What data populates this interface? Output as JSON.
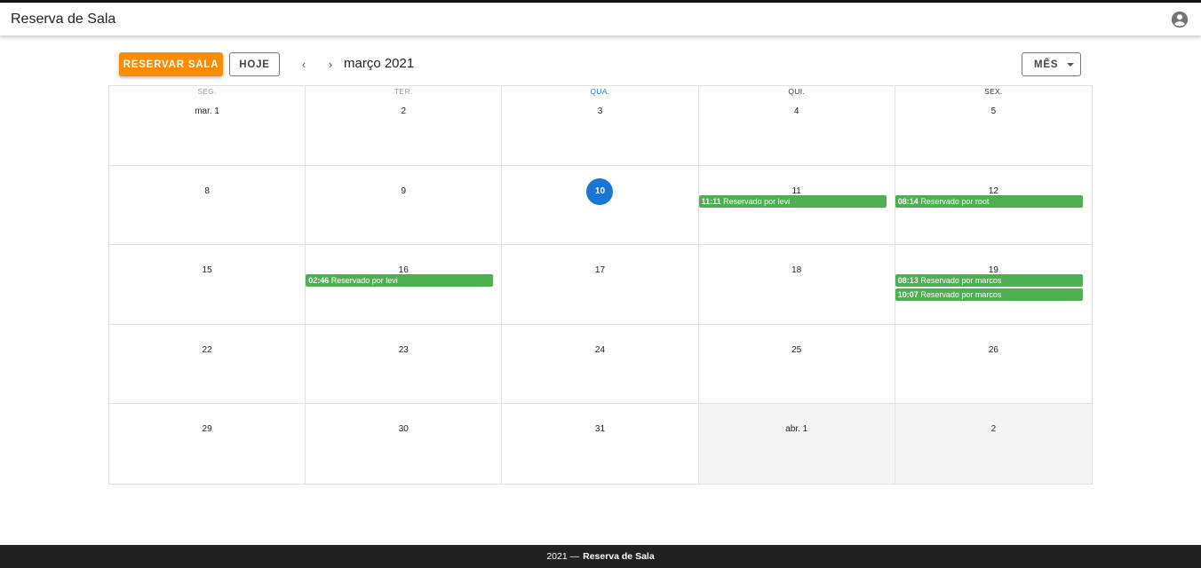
{
  "app": {
    "title": "Reserva de Sala",
    "account_icon": "account-circle-icon"
  },
  "toolbar": {
    "reserve_label": "RESERVAR SALA",
    "today_label": "HOJE",
    "prev_icon": "chevron-left-icon",
    "next_icon": "chevron-right-icon",
    "month_label": "março 2021",
    "view_label": "MÊS",
    "view_caret_icon": "caret-down-icon"
  },
  "weekdays": [
    "SEG.",
    "TER.",
    "QUA.",
    "QUI.",
    "SEX."
  ],
  "weeks": [
    [
      {
        "label": "mar. 1",
        "events": []
      },
      {
        "label": "2",
        "events": []
      },
      {
        "label": "3",
        "events": []
      },
      {
        "label": "4",
        "events": []
      },
      {
        "label": "5",
        "events": []
      }
    ],
    [
      {
        "label": "8",
        "events": []
      },
      {
        "label": "9",
        "events": []
      },
      {
        "label": "10",
        "today": true,
        "events": []
      },
      {
        "label": "11",
        "events": [
          {
            "time": "11:11",
            "text": "Reservado por levi"
          }
        ]
      },
      {
        "label": "12",
        "events": [
          {
            "time": "08:14",
            "text": "Reservado por root"
          }
        ]
      }
    ],
    [
      {
        "label": "15",
        "events": []
      },
      {
        "label": "16",
        "events": [
          {
            "time": "02:46",
            "text": "Reservado por levi"
          }
        ]
      },
      {
        "label": "17",
        "events": []
      },
      {
        "label": "18",
        "events": []
      },
      {
        "label": "19",
        "events": [
          {
            "time": "08:13",
            "text": "Reservado por marcos"
          },
          {
            "time": "10:07",
            "text": "Reservado por marcos"
          }
        ]
      }
    ],
    [
      {
        "label": "22",
        "events": []
      },
      {
        "label": "23",
        "events": []
      },
      {
        "label": "24",
        "events": []
      },
      {
        "label": "25",
        "events": []
      },
      {
        "label": "26",
        "events": []
      }
    ],
    [
      {
        "label": "29",
        "events": []
      },
      {
        "label": "30",
        "events": []
      },
      {
        "label": "31",
        "events": []
      },
      {
        "label": "abr. 1",
        "outside": true,
        "events": []
      },
      {
        "label": "2",
        "outside": true,
        "events": []
      }
    ]
  ],
  "colors": {
    "primary": "#1976d2",
    "reserve_button": "#fb8c00",
    "event": "#4caf50",
    "footer": "#212121"
  },
  "footer": {
    "year": "2021 —",
    "brand": "Reserva de Sala"
  }
}
